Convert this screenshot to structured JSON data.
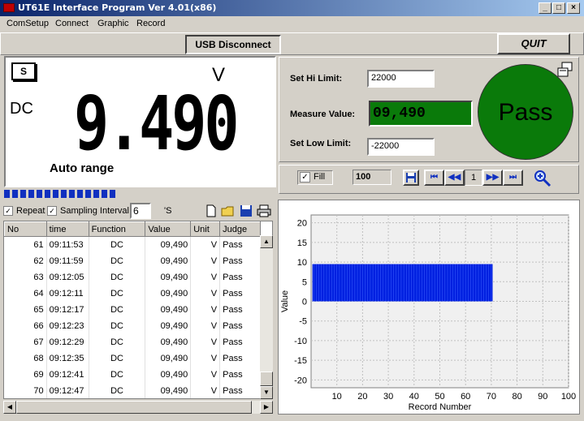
{
  "window": {
    "title": "UT61E Interface Program Ver 4.01(x86)",
    "min": "_",
    "max": "□",
    "close": "×"
  },
  "menu": [
    "ComSetup",
    "Connect",
    "Graphic",
    "Record"
  ],
  "toolbar": {
    "usb": "USB Disconnect",
    "quit": "QUIT"
  },
  "display": {
    "s": "S",
    "unit": "V",
    "mode": "DC",
    "reading": "9.490",
    "range": "Auto range",
    "bar_segments": 14
  },
  "limits": {
    "hi_label": "Set Hi Limit:",
    "hi_value": "22000",
    "measure_label": "Measure Value:",
    "measure_value": "09,490",
    "low_label": "Set Low Limit:",
    "low_value": "-22000",
    "result": "Pass"
  },
  "controls": {
    "fill_label": "Fill",
    "fill_checked": true,
    "count": "100",
    "page": "1"
  },
  "sampling": {
    "repeat_label": "Repeat",
    "interval_label": "Sampling Interval",
    "interval_value": "6",
    "unit": "'S"
  },
  "table": {
    "headers": [
      "No",
      "time",
      "Function",
      "Value",
      "Unit",
      "Judge"
    ],
    "rows": [
      [
        "61",
        "09:11:53",
        "DC",
        "09,490",
        "V",
        "Pass"
      ],
      [
        "62",
        "09:11:59",
        "DC",
        "09,490",
        "V",
        "Pass"
      ],
      [
        "63",
        "09:12:05",
        "DC",
        "09,490",
        "V",
        "Pass"
      ],
      [
        "64",
        "09:12:11",
        "DC",
        "09,490",
        "V",
        "Pass"
      ],
      [
        "65",
        "09:12:17",
        "DC",
        "09,490",
        "V",
        "Pass"
      ],
      [
        "66",
        "09:12:23",
        "DC",
        "09,490",
        "V",
        "Pass"
      ],
      [
        "67",
        "09:12:29",
        "DC",
        "09,490",
        "V",
        "Pass"
      ],
      [
        "68",
        "09:12:35",
        "DC",
        "09,490",
        "V",
        "Pass"
      ],
      [
        "69",
        "09:12:41",
        "DC",
        "09,490",
        "V",
        "Pass"
      ],
      [
        "70",
        "09:12:47",
        "DC",
        "09,490",
        "V",
        "Pass"
      ]
    ]
  },
  "chart_data": {
    "type": "area",
    "xlabel": "Record Number",
    "ylabel": "Value",
    "xlim": [
      0,
      100
    ],
    "ylim": [
      -22,
      22
    ],
    "xticks": [
      10,
      20,
      30,
      40,
      50,
      60,
      70,
      80,
      90,
      100
    ],
    "yticks": [
      20,
      15,
      10,
      5,
      0,
      -5,
      -10,
      -15,
      -20
    ],
    "series": [
      {
        "x_start": 1,
        "x_end": 70,
        "value": 9.49,
        "color": "#0020e0"
      }
    ],
    "grid": true
  },
  "colors": {
    "pass_green": "#0a7a0a",
    "bar_blue": "#0020e0",
    "title_blue": "#0a246a"
  }
}
